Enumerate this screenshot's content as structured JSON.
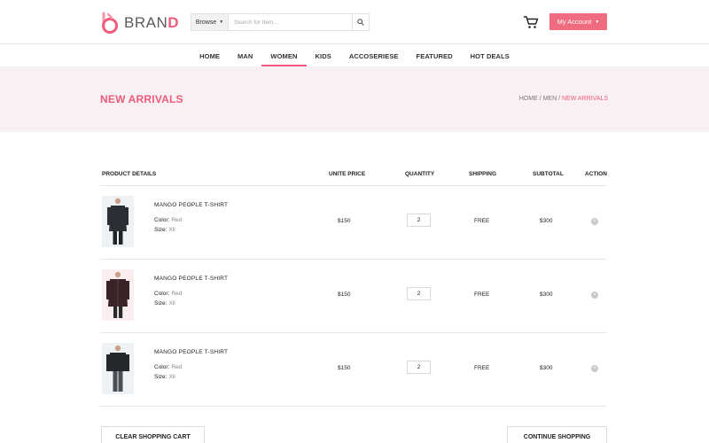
{
  "brand": {
    "part1": "BRAN",
    "part2": "D",
    "accent_color": "#ef5b7b"
  },
  "search": {
    "browse_label": "Browse",
    "placeholder": "Search for Item..."
  },
  "header": {
    "account_label": "My Account"
  },
  "nav": {
    "items": [
      {
        "label": "HOME"
      },
      {
        "label": "MAN"
      },
      {
        "label": "WOMEN"
      },
      {
        "label": "KIDS"
      },
      {
        "label": "ACCOSERIESE"
      },
      {
        "label": "FEATURED"
      },
      {
        "label": "HOT DEALS"
      }
    ]
  },
  "banner": {
    "title": "NEW ARRIVALS",
    "breadcrumb": {
      "home": "HOME",
      "sep1": " / ",
      "parent": "MEN",
      "sep2": " / ",
      "current": "NEW ARRIVALS"
    }
  },
  "table": {
    "headers": {
      "product": "PRODUCT DETAILS",
      "price": "UNITE PRICE",
      "quantity": "QUANTITY",
      "shipping": "SHIPPING",
      "subtotal": "SUBTOTAL",
      "action": "ACTION"
    },
    "color_label": "Color:",
    "size_label": "Size:",
    "rows": [
      {
        "name": "MANGO  PEOPLE  T-SHIRT",
        "color": "Red",
        "size": "Xll",
        "price": "$150",
        "quantity": "2",
        "shipping": "FREE",
        "subtotal": "$300"
      },
      {
        "name": "MANGO  PEOPLE  T-SHIRT",
        "color": "Red",
        "size": "Xll",
        "price": "$150",
        "quantity": "2",
        "shipping": "FREE",
        "subtotal": "$300"
      },
      {
        "name": "MANGO  PEOPLE  T-SHIRT",
        "color": "Red",
        "size": "Xll",
        "price": "$150",
        "quantity": "2",
        "shipping": "FREE",
        "subtotal": "$300"
      }
    ]
  },
  "actions": {
    "clear_label": "CLEAR SHOPPING CART",
    "continue_label": "CONTINUE SHOPPING"
  }
}
